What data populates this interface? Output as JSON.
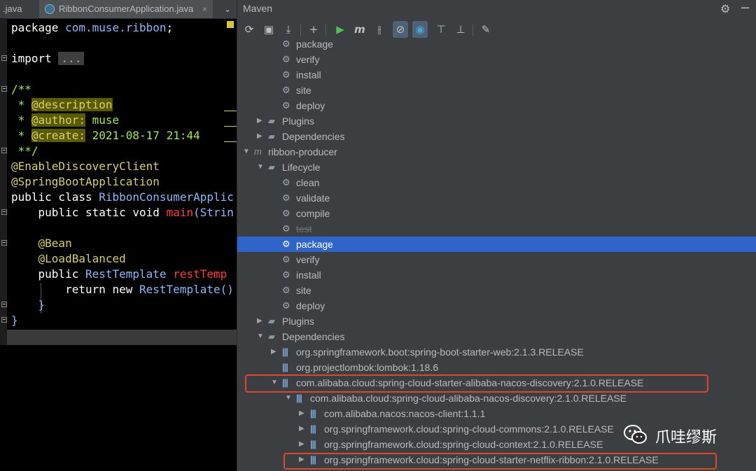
{
  "editor": {
    "tabs": [
      {
        "label": ".java",
        "active": false
      },
      {
        "label": "RibbonConsumerApplication.java",
        "active": true
      }
    ],
    "close_glyph": "×",
    "chevron_glyph": "⌄",
    "lines": {
      "l1_kw": "package",
      "l1_pkg": " com.muse.ribbon",
      "l1_semi": ";",
      "l2_kw": "import",
      "l2_ellipsis": "...",
      "l3": "/**",
      "l4_star": " * ",
      "l4_tag": "@description",
      "l5_star": " * ",
      "l5_tag": "@author:",
      "l5_val": " muse",
      "l6_star": " * ",
      "l6_tag": "@create:",
      "l6_val": " 2021-08-17 21:44",
      "l7": " **/",
      "l8": "@EnableDiscoveryClient",
      "l9": "@SpringBootApplication",
      "l10_kw": "public class ",
      "l10_name": "RibbonConsumerApplic",
      "l11_kw": "    public static void ",
      "l11_name": "main",
      "l11_rest": "(Strin",
      "l12": "    @Bean",
      "l13": "    @LoadBalanced",
      "l14_kw": "    public ",
      "l14_type": "RestTemplate ",
      "l14_name": "restTemp",
      "l15_kw": "        return new ",
      "l15_type": "RestTemplate()",
      "l16": "    }",
      "l17": "}"
    }
  },
  "maven": {
    "title": "Maven",
    "gear_glyph": "⚙",
    "minus_glyph": "−",
    "toolbar": [
      {
        "name": "reload-icon",
        "glyph": "⟳"
      },
      {
        "name": "add-folder-icon",
        "glyph": "▣"
      },
      {
        "name": "download-icon",
        "glyph": "⤓"
      },
      {
        "name": "add-icon",
        "glyph": "+"
      },
      {
        "name": "run-icon",
        "glyph": "▶"
      },
      {
        "name": "execute-goal-icon",
        "glyph": "m"
      },
      {
        "name": "skip-tests-icon",
        "glyph": "⫲"
      },
      {
        "name": "offline-icon",
        "glyph": "⊘"
      },
      {
        "name": "show-dependencies-icon",
        "glyph": "◉"
      },
      {
        "name": "collapse-all-icon",
        "glyph": "⊤"
      },
      {
        "name": "expand-all-icon",
        "glyph": "⊥"
      },
      {
        "name": "settings-wrench-icon",
        "glyph": "✎"
      }
    ],
    "tree": [
      {
        "label": "package",
        "icon": "gear",
        "indent": 3,
        "arrow": ""
      },
      {
        "label": "verify",
        "icon": "gear",
        "indent": 3,
        "arrow": ""
      },
      {
        "label": "install",
        "icon": "gear",
        "indent": 3,
        "arrow": ""
      },
      {
        "label": "site",
        "icon": "gear",
        "indent": 3,
        "arrow": ""
      },
      {
        "label": "deploy",
        "icon": "gear",
        "indent": 3,
        "arrow": ""
      },
      {
        "label": "Plugins",
        "icon": "folder",
        "indent": 2,
        "arrow": "▶"
      },
      {
        "label": "Dependencies",
        "icon": "folder",
        "indent": 2,
        "arrow": "▶"
      },
      {
        "label": "ribbon-producer",
        "icon": "module",
        "indent": 1,
        "arrow": "▼"
      },
      {
        "label": "Lifecycle",
        "icon": "folder",
        "indent": 2,
        "arrow": "▼"
      },
      {
        "label": "clean",
        "icon": "gear",
        "indent": 3,
        "arrow": ""
      },
      {
        "label": "validate",
        "icon": "gear",
        "indent": 3,
        "arrow": ""
      },
      {
        "label": "compile",
        "icon": "gear",
        "indent": 3,
        "arrow": ""
      },
      {
        "label": "test",
        "icon": "gear",
        "indent": 3,
        "arrow": "",
        "strike": true
      },
      {
        "label": "package",
        "icon": "gear",
        "indent": 3,
        "arrow": "",
        "selected": true
      },
      {
        "label": "verify",
        "icon": "gear",
        "indent": 3,
        "arrow": ""
      },
      {
        "label": "install",
        "icon": "gear",
        "indent": 3,
        "arrow": ""
      },
      {
        "label": "site",
        "icon": "gear",
        "indent": 3,
        "arrow": ""
      },
      {
        "label": "deploy",
        "icon": "gear",
        "indent": 3,
        "arrow": ""
      },
      {
        "label": "Plugins",
        "icon": "folder",
        "indent": 2,
        "arrow": "▶"
      },
      {
        "label": "Dependencies",
        "icon": "folder",
        "indent": 2,
        "arrow": "▼"
      },
      {
        "label": "org.springframework.boot:spring-boot-starter-web:2.1.3.RELEASE",
        "icon": "bars",
        "indent": 3,
        "arrow": "▶"
      },
      {
        "label": "org.projectlombok:lombok:1.18.6",
        "icon": "bars",
        "indent": 3,
        "arrow": ""
      },
      {
        "label": "com.alibaba.cloud:spring-cloud-starter-alibaba-nacos-discovery:2.1.0.RELEASE",
        "icon": "bars",
        "indent": 3,
        "arrow": "▼",
        "boxed": true
      },
      {
        "label": "com.alibaba.cloud:spring-cloud-alibaba-nacos-discovery:2.1.0.RELEASE",
        "icon": "bars",
        "indent": 4,
        "arrow": "▼"
      },
      {
        "label": "com.alibaba.nacos:nacos-client:1.1.1",
        "icon": "bars",
        "indent": 5,
        "arrow": "▶"
      },
      {
        "label": "org.springframework.cloud:spring-cloud-commons:2.1.0.RELEASE",
        "icon": "bars",
        "indent": 5,
        "arrow": "▶"
      },
      {
        "label": "org.springframework.cloud:spring-cloud-context:2.1.0.RELEASE",
        "icon": "bars",
        "indent": 5,
        "arrow": "▶"
      },
      {
        "label": "org.springframework.cloud:spring-cloud-starter-netflix-ribbon:2.1.0.RELEASE",
        "icon": "bars",
        "indent": 5,
        "arrow": "▶",
        "boxed": true
      }
    ]
  },
  "watermark": {
    "text": "爪哇缪斯"
  },
  "colors": {
    "selection": "#2f65ca",
    "highlight_box": "#e0452e",
    "panel_bg": "#3c3f41",
    "editor_bg": "#000000"
  }
}
